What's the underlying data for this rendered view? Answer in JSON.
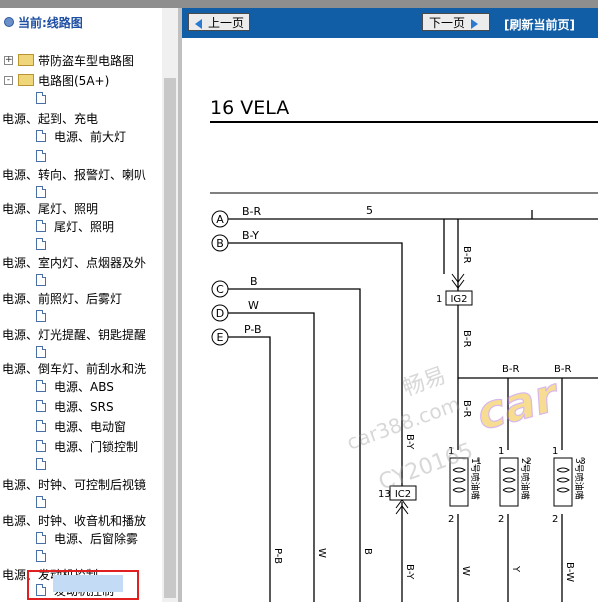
{
  "window": {
    "title": "当前:线路图"
  },
  "toolbar": {
    "prev_label": "上一页",
    "next_label": "下一页",
    "refresh_label": "[刷新当前页]"
  },
  "tree": {
    "root": "当前:线路图",
    "items": [
      {
        "label": "带防盗车型电路图",
        "type": "folder",
        "expander": "+"
      },
      {
        "label": "电路图(5A+)",
        "type": "folder",
        "expander": "-"
      },
      {
        "label": "",
        "type": "doc"
      },
      {
        "label": "电源、起到、充电",
        "type": "text"
      },
      {
        "label": "电源、前大灯",
        "type": "doc"
      },
      {
        "label": "",
        "type": "doc"
      },
      {
        "label": "电源、转向、报警灯、喇叭",
        "type": "text"
      },
      {
        "label": "",
        "type": "doc"
      },
      {
        "label": "电源、尾灯、照明",
        "type": "text"
      },
      {
        "label": "尾灯、照明",
        "type": "doc"
      },
      {
        "label": "",
        "type": "doc"
      },
      {
        "label": "电源、室内灯、点烟器及外",
        "type": "text"
      },
      {
        "label": "",
        "type": "doc"
      },
      {
        "label": "电源、前照灯、后雾灯",
        "type": "text"
      },
      {
        "label": "",
        "type": "doc"
      },
      {
        "label": "电源、灯光提醒、钥匙提醒",
        "type": "text"
      },
      {
        "label": "",
        "type": "doc"
      },
      {
        "label": "电源、倒车灯、前刮水和洗",
        "type": "text"
      },
      {
        "label": "电源、ABS",
        "type": "doc"
      },
      {
        "label": "电源、SRS",
        "type": "doc"
      },
      {
        "label": "电源、电动窗",
        "type": "doc"
      },
      {
        "label": "电源、门锁控制",
        "type": "doc"
      },
      {
        "label": "",
        "type": "doc"
      },
      {
        "label": "电源、时钟、可控制后视镜",
        "type": "text"
      },
      {
        "label": "",
        "type": "doc"
      },
      {
        "label": "电源、时钟、收音机和播放",
        "type": "text"
      },
      {
        "label": "电源、后窗除雾",
        "type": "doc"
      },
      {
        "label": "",
        "type": "doc"
      },
      {
        "label": "电源、发动机控制",
        "type": "text"
      },
      {
        "label": "发动机控制",
        "type": "doc",
        "selected": true
      }
    ]
  },
  "diagram": {
    "title": "16 VELA",
    "circle_labels": [
      "A",
      "B",
      "C",
      "D",
      "E"
    ],
    "wire_labels": [
      "B-R",
      "B-Y",
      "B",
      "W",
      "P-B"
    ],
    "bus_number": "5",
    "connectors": [
      {
        "pin": "1",
        "name": "IG2"
      },
      {
        "pin": "13",
        "name": "IC2"
      }
    ],
    "vertical_labels": [
      "B-R",
      "B-R",
      "B-R",
      "B-Y",
      "B-Y",
      "P-B",
      "W",
      "B",
      "W",
      "Y",
      "B-W"
    ],
    "top_right_labels": [
      "B-R",
      "B-R"
    ],
    "injectors": [
      {
        "name": "1号喷油嘴",
        "pin_top": "1",
        "pin_bottom": "2"
      },
      {
        "name": "2号喷油嘴",
        "pin_top": "1",
        "pin_bottom": "2"
      },
      {
        "name": "3号喷油嘴",
        "pin_top": "1",
        "pin_bottom": "2"
      }
    ],
    "injector_numbers": [
      "1",
      "2",
      "3"
    ],
    "watermark": {
      "line1": "畅易",
      "line2": "car388.com",
      "line3": "CY20165",
      "logo": "car"
    }
  },
  "colors": {
    "nav_blue": "#125ea6",
    "selection_border": "#e02020",
    "selection_bg": "#c3dbf5",
    "tree_title": "#1e4fa3"
  }
}
